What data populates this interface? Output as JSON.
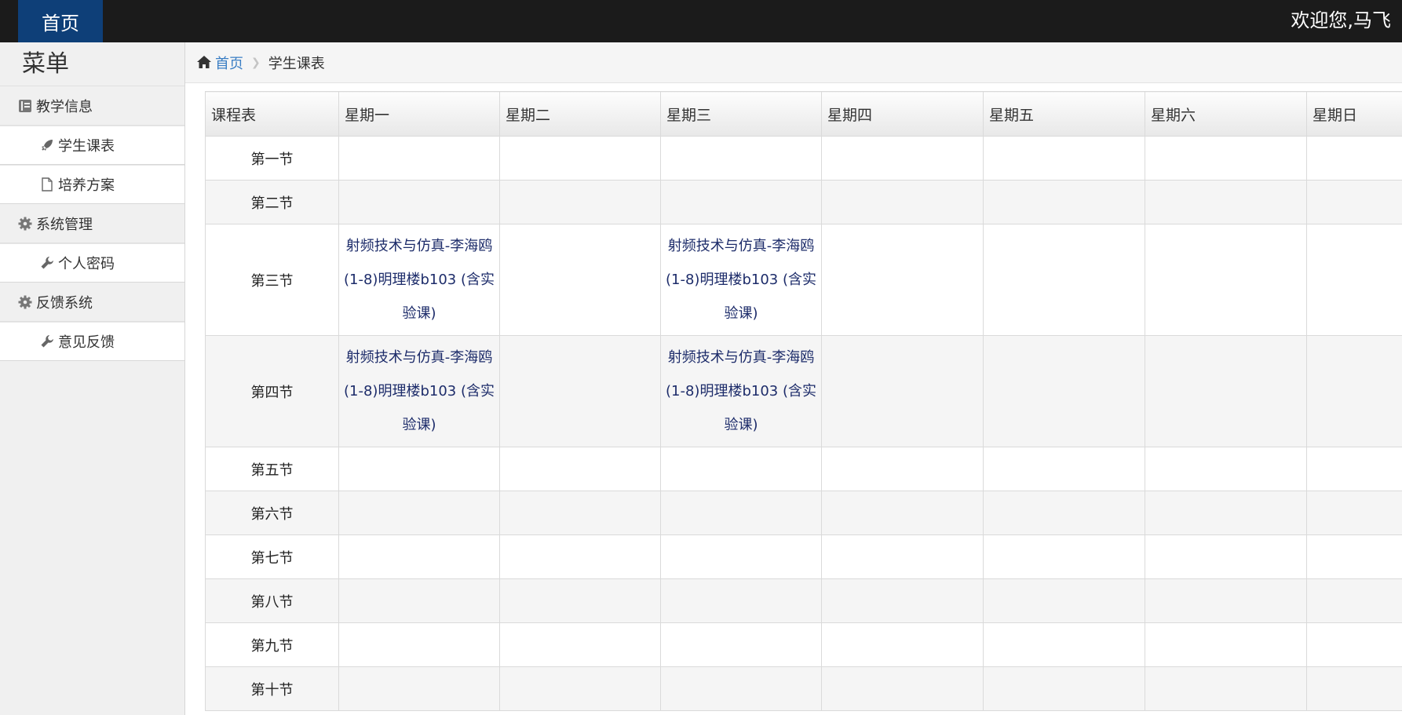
{
  "topbar": {
    "home_label": "首页",
    "welcome": "欢迎您,马飞",
    "bg_color": "#1b1b1b",
    "home_bg_color": "#0e3f78"
  },
  "sidebar": {
    "title": "菜单",
    "groups": [
      {
        "label": "教学信息",
        "icon": "book-icon",
        "items": [
          {
            "label": "学生课表",
            "icon": "rocket-icon"
          },
          {
            "label": "培养方案",
            "icon": "file-icon"
          }
        ]
      },
      {
        "label": "系统管理",
        "icon": "gear-icon",
        "items": [
          {
            "label": "个人密码",
            "icon": "wrench-icon"
          }
        ]
      },
      {
        "label": "反馈系统",
        "icon": "gear-icon",
        "items": [
          {
            "label": "意见反馈",
            "icon": "wrench-icon"
          }
        ]
      }
    ]
  },
  "breadcrumb": {
    "home": "首页",
    "current": "学生课表",
    "link_color": "#3a7ec4"
  },
  "schedule": {
    "headers": [
      "课程表",
      "星期一",
      "星期二",
      "星期三",
      "星期四",
      "星期五",
      "星期六",
      "星期日"
    ],
    "rows": [
      {
        "period": "第一节",
        "cells": [
          "",
          "",
          "",
          "",
          "",
          "",
          ""
        ]
      },
      {
        "period": "第二节",
        "cells": [
          "",
          "",
          "",
          "",
          "",
          "",
          ""
        ]
      },
      {
        "period": "第三节",
        "cells": [
          "射频技术与仿真-李海鸥(1-8)明理楼b103 (含实验课)",
          "",
          "射频技术与仿真-李海鸥(1-8)明理楼b103 (含实验课)",
          "",
          "",
          "",
          ""
        ]
      },
      {
        "period": "第四节",
        "cells": [
          "射频技术与仿真-李海鸥(1-8)明理楼b103 (含实验课)",
          "",
          "射频技术与仿真-李海鸥(1-8)明理楼b103 (含实验课)",
          "",
          "",
          "",
          ""
        ]
      },
      {
        "period": "第五节",
        "cells": [
          "",
          "",
          "",
          "",
          "",
          "",
          ""
        ]
      },
      {
        "period": "第六节",
        "cells": [
          "",
          "",
          "",
          "",
          "",
          "",
          ""
        ]
      },
      {
        "period": "第七节",
        "cells": [
          "",
          "",
          "",
          "",
          "",
          "",
          ""
        ]
      },
      {
        "period": "第八节",
        "cells": [
          "",
          "",
          "",
          "",
          "",
          "",
          ""
        ]
      },
      {
        "period": "第九节",
        "cells": [
          "",
          "",
          "",
          "",
          "",
          "",
          ""
        ]
      },
      {
        "period": "第十节",
        "cells": [
          "",
          "",
          "",
          "",
          "",
          "",
          ""
        ]
      }
    ],
    "course_text_color": "#1d2c6a"
  }
}
